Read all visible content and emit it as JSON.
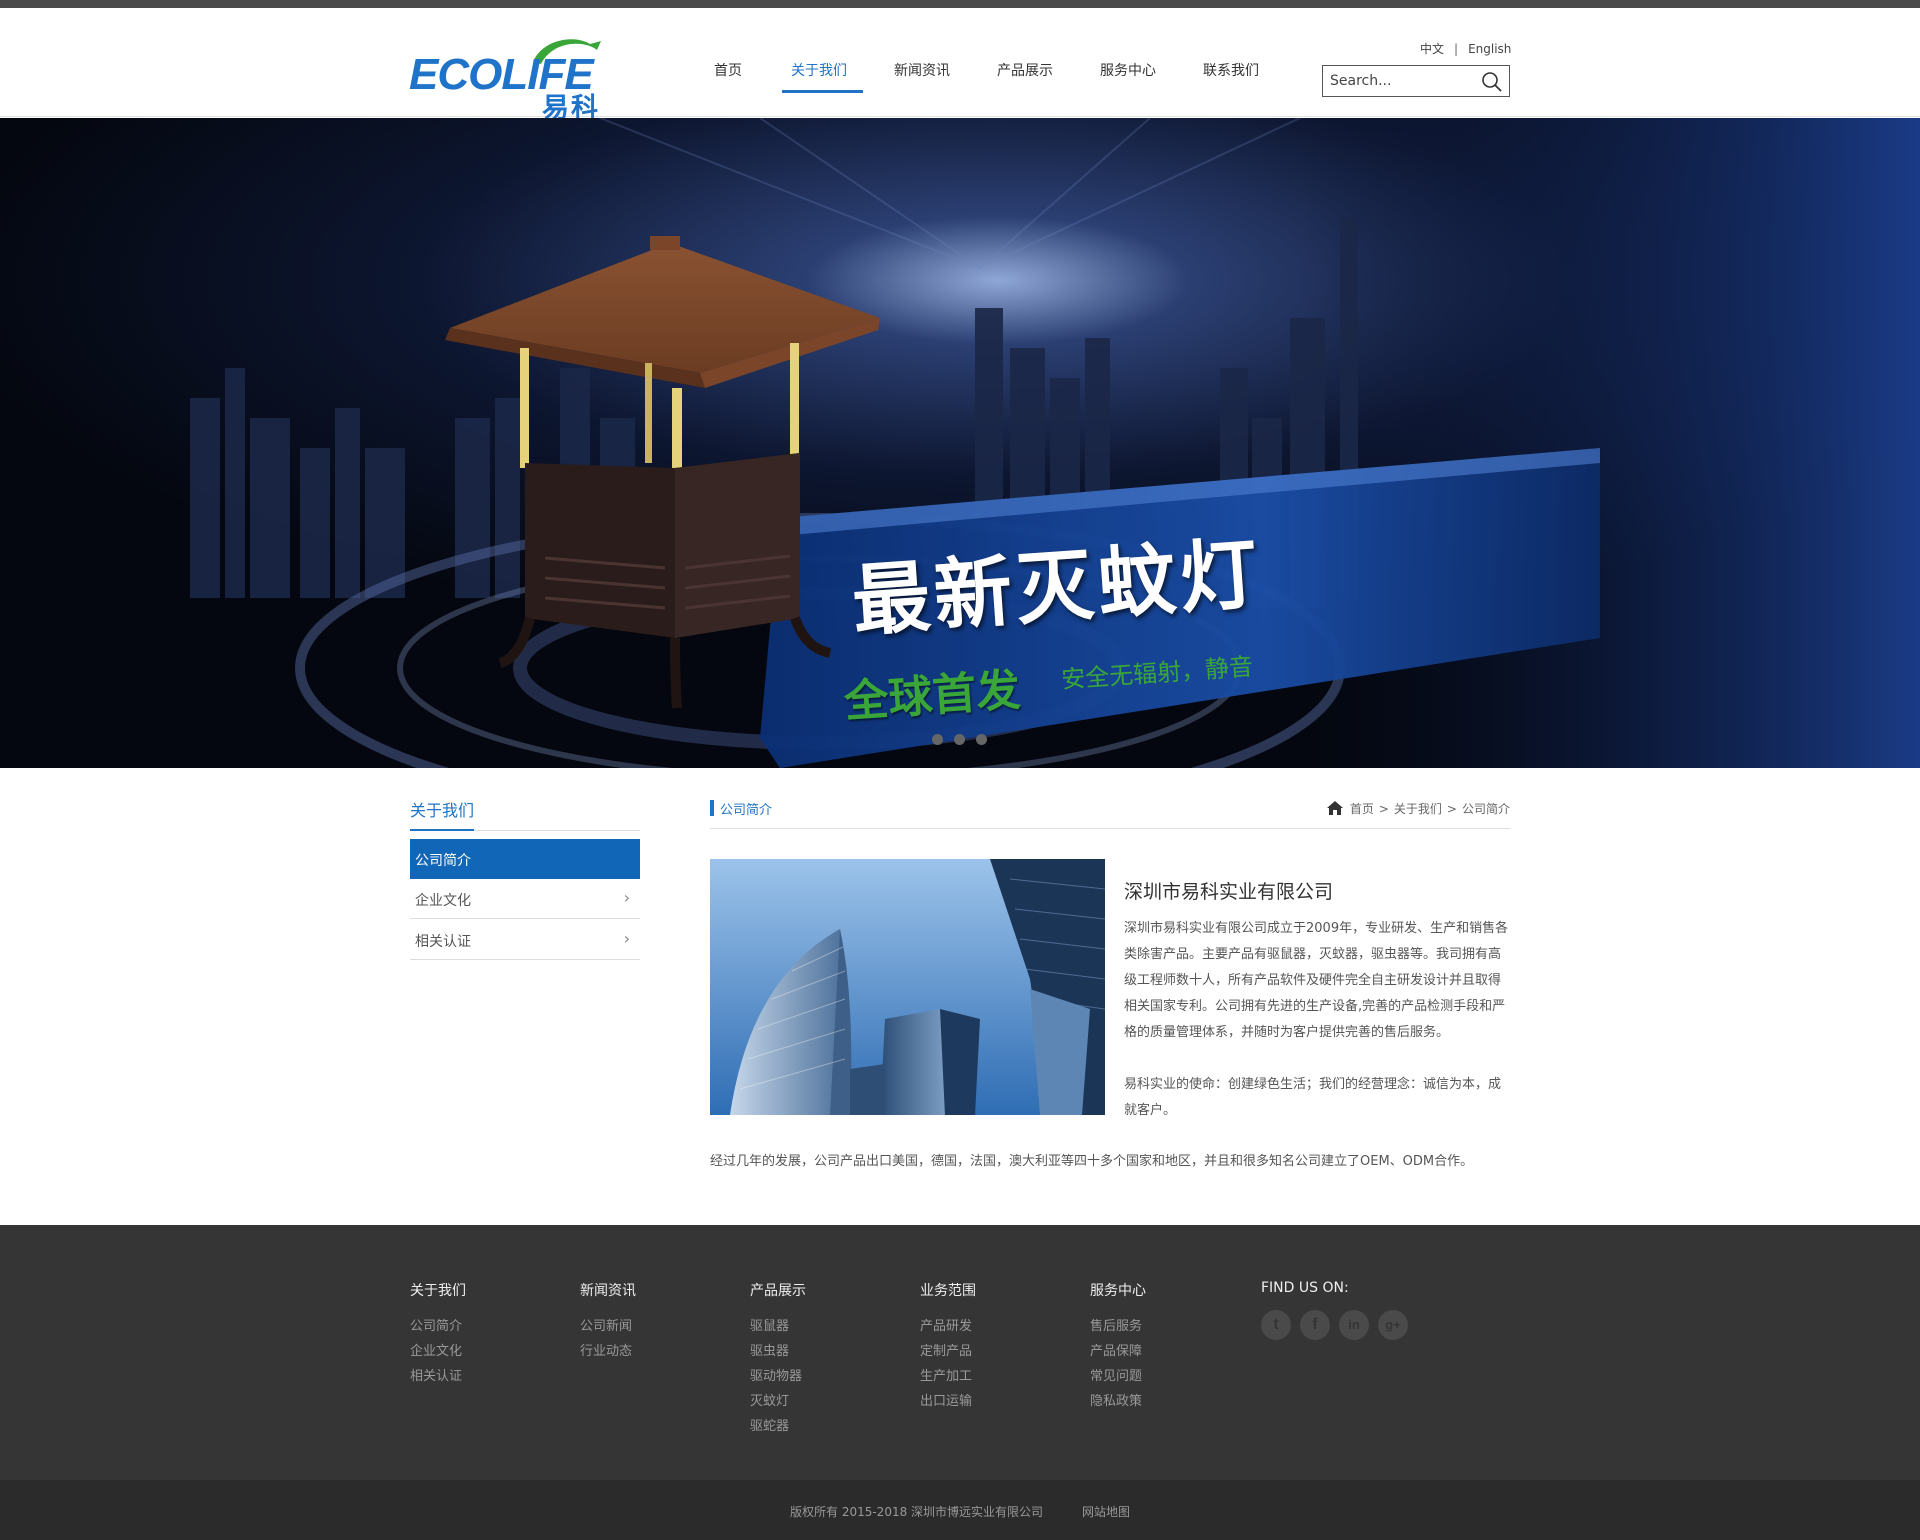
{
  "header": {
    "logo_text_left": "ECO",
    "logo_text_right": "LIFE",
    "logo_cn": "易科",
    "nav": [
      {
        "label": "首页"
      },
      {
        "label": "关于我们"
      },
      {
        "label": "新闻资讯"
      },
      {
        "label": "产品展示"
      },
      {
        "label": "服务中心"
      },
      {
        "label": "联系我们"
      }
    ],
    "active_nav": "关于我们",
    "lang_cn": "中文",
    "lang_sep": "|",
    "lang_en": "English",
    "search_placeholder": "Search..."
  },
  "banner": {
    "headline": "最新灭蚊灯",
    "sub": "全球首发",
    "sub2": "安全无辐射，静音",
    "slide_count": 3
  },
  "sidebar": {
    "title": "关于我们",
    "items": [
      {
        "label": "公司简介",
        "active": true
      },
      {
        "label": "企业文化",
        "chevron": "›"
      },
      {
        "label": "相关认证",
        "chevron": "›"
      }
    ]
  },
  "main": {
    "section_title": "公司简介",
    "breadcrumb": [
      "首页",
      "关于我们",
      "公司简介"
    ],
    "breadcrumb_sep": ">",
    "company_name": "深圳市易科实业有限公司",
    "para1": "深圳市易科实业有限公司成立于2009年，专业研发、生产和销售各类除害产品。主要产品有驱鼠器，灭蚊器，驱虫器等。我司拥有高级工程师数十人，所有产品软件及硬件完全自主研发设计并且取得相关国家专利。公司拥有先进的生产设备,完善的产品检测手段和严格的质量管理体系，并随时为客户提供完善的售后服务。",
    "para2": "易科实业的使命：创建绿色生活；我们的经营理念：诚信为本，成就客户。",
    "para3": "经过几年的发展，公司产品出口美国，德国，法国，澳大利亚等四十多个国家和地区，并且和很多知名公司建立了OEM、ODM合作。"
  },
  "footer": {
    "columns": [
      {
        "title": "关于我们",
        "links": [
          "公司简介",
          "企业文化",
          "相关认证"
        ]
      },
      {
        "title": "新闻资讯",
        "links": [
          "公司新闻",
          "行业动态"
        ]
      },
      {
        "title": "产品展示",
        "links": [
          "驱鼠器",
          "驱虫器",
          "驱动物器",
          "灭蚊灯",
          "驱蛇器"
        ]
      },
      {
        "title": "业务范围",
        "links": [
          "产品研发",
          "定制产品",
          "生产加工",
          "出口运输"
        ]
      },
      {
        "title": "服务中心",
        "links": [
          "售后服务",
          "产品保障",
          "常见问题",
          "隐私政策"
        ]
      }
    ],
    "find_us": "FIND US ON:",
    "social": [
      {
        "icon": "twitter-icon",
        "glyph": "t"
      },
      {
        "icon": "facebook-icon",
        "glyph": "f"
      },
      {
        "icon": "linkedin-icon",
        "glyph": "in"
      },
      {
        "icon": "googleplus-icon",
        "glyph": "g+"
      }
    ],
    "copyright": "版权所有 2015-2018 深圳市博远实业有限公司",
    "sitemap": "网站地图"
  },
  "colors": {
    "accent": "#1f73c8",
    "footer_bg": "#353535",
    "copyright_bg": "#2b2b2b",
    "banner_green": "#3aa63a"
  }
}
